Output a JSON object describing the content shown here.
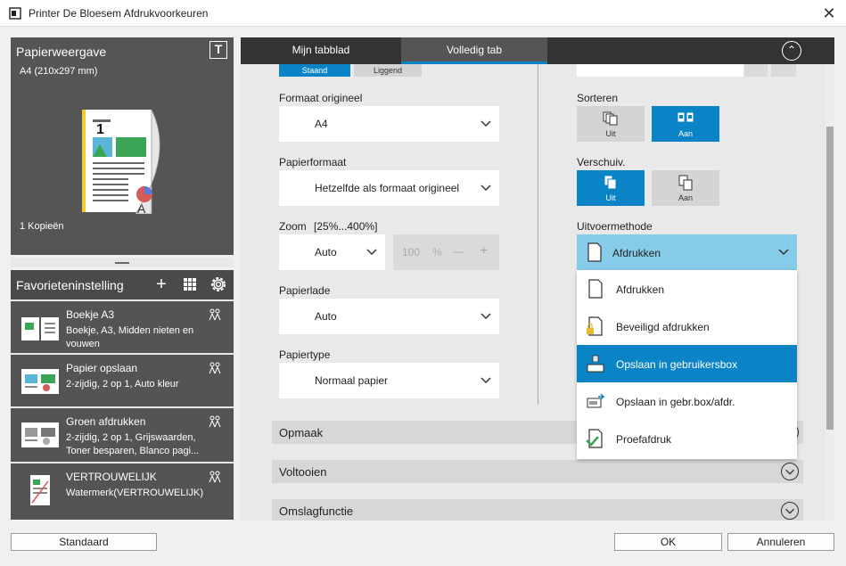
{
  "window": {
    "title": "Printer De Bloesem Afdrukvoorkeuren",
    "close_glyph": "✕"
  },
  "preview": {
    "title": "Papierweergave",
    "t_glyph": "T",
    "paper_size": "A4 (210x297 mm)",
    "copies": "1 Kopieën"
  },
  "favorites": {
    "title": "Favorieteninstelling",
    "add_glyph": "+",
    "items": [
      {
        "name": "Boekje A3",
        "desc": "Boekje, A3, Midden nieten en vouwen"
      },
      {
        "name": "Papier opslaan",
        "desc": "2-zijdig, 2 op 1, Auto kleur"
      },
      {
        "name": "Groen afdrukken",
        "desc": "2-zijdig, 2 op 1, Grijswaarden, Toner besparen, Blanco pagi..."
      },
      {
        "name": "VERTROUWELIJK",
        "desc": "Watermerk(VERTROUWELIJK)"
      }
    ]
  },
  "tabs": [
    {
      "label": "Mijn tabblad"
    },
    {
      "label": "Volledig tab"
    }
  ],
  "tabs_collapse_glyph": "⌃",
  "orientation": {
    "portrait": "Staand",
    "landscape": "Liggend",
    "selected": "portrait"
  },
  "fields": {
    "original_format": {
      "label": "Formaat origineel",
      "value": "A4"
    },
    "paper_format": {
      "label": "Papierformaat",
      "value": "Hetzelfde als formaat origineel"
    },
    "zoom": {
      "label": "Zoom",
      "range": "[25%...400%]",
      "value": "Auto",
      "number": "100",
      "unit": "%",
      "minus": "—",
      "plus": "+"
    },
    "paper_tray": {
      "label": "Papierlade",
      "value": "Auto"
    },
    "paper_type": {
      "label": "Papiertype",
      "value": "Normaal papier"
    }
  },
  "sort": {
    "label": "Sorteren",
    "off": "Uit",
    "on": "Aan",
    "selected": "on"
  },
  "offset": {
    "label": "Verschuiv.",
    "off": "Uit",
    "on": "Aan",
    "selected": "off"
  },
  "output": {
    "label": "Uitvoermethode",
    "value": "Afdrukken",
    "options": [
      {
        "label": "Afdrukken",
        "icon": "page-icon"
      },
      {
        "label": "Beveiligd afdrukken",
        "icon": "lock-page-icon"
      },
      {
        "label": "Opslaan in gebruikersbox",
        "icon": "box-store-icon"
      },
      {
        "label": "Opslaan in gebr.box/afdr.",
        "icon": "box-print-icon"
      },
      {
        "label": "Proefafdruk",
        "icon": "proof-check-icon"
      }
    ],
    "highlighted": "Opslaan in gebruikersbox"
  },
  "sections": [
    {
      "label": "Opmaak"
    },
    {
      "label": "Voltooien"
    },
    {
      "label": "Omslagfunctie"
    }
  ],
  "buttons": {
    "default": "Standaard",
    "ok": "OK",
    "cancel": "Annuleren"
  },
  "colors": {
    "accent": "#0a84c6",
    "dropdown_head": "#86cbe8",
    "panel": "#555555"
  }
}
